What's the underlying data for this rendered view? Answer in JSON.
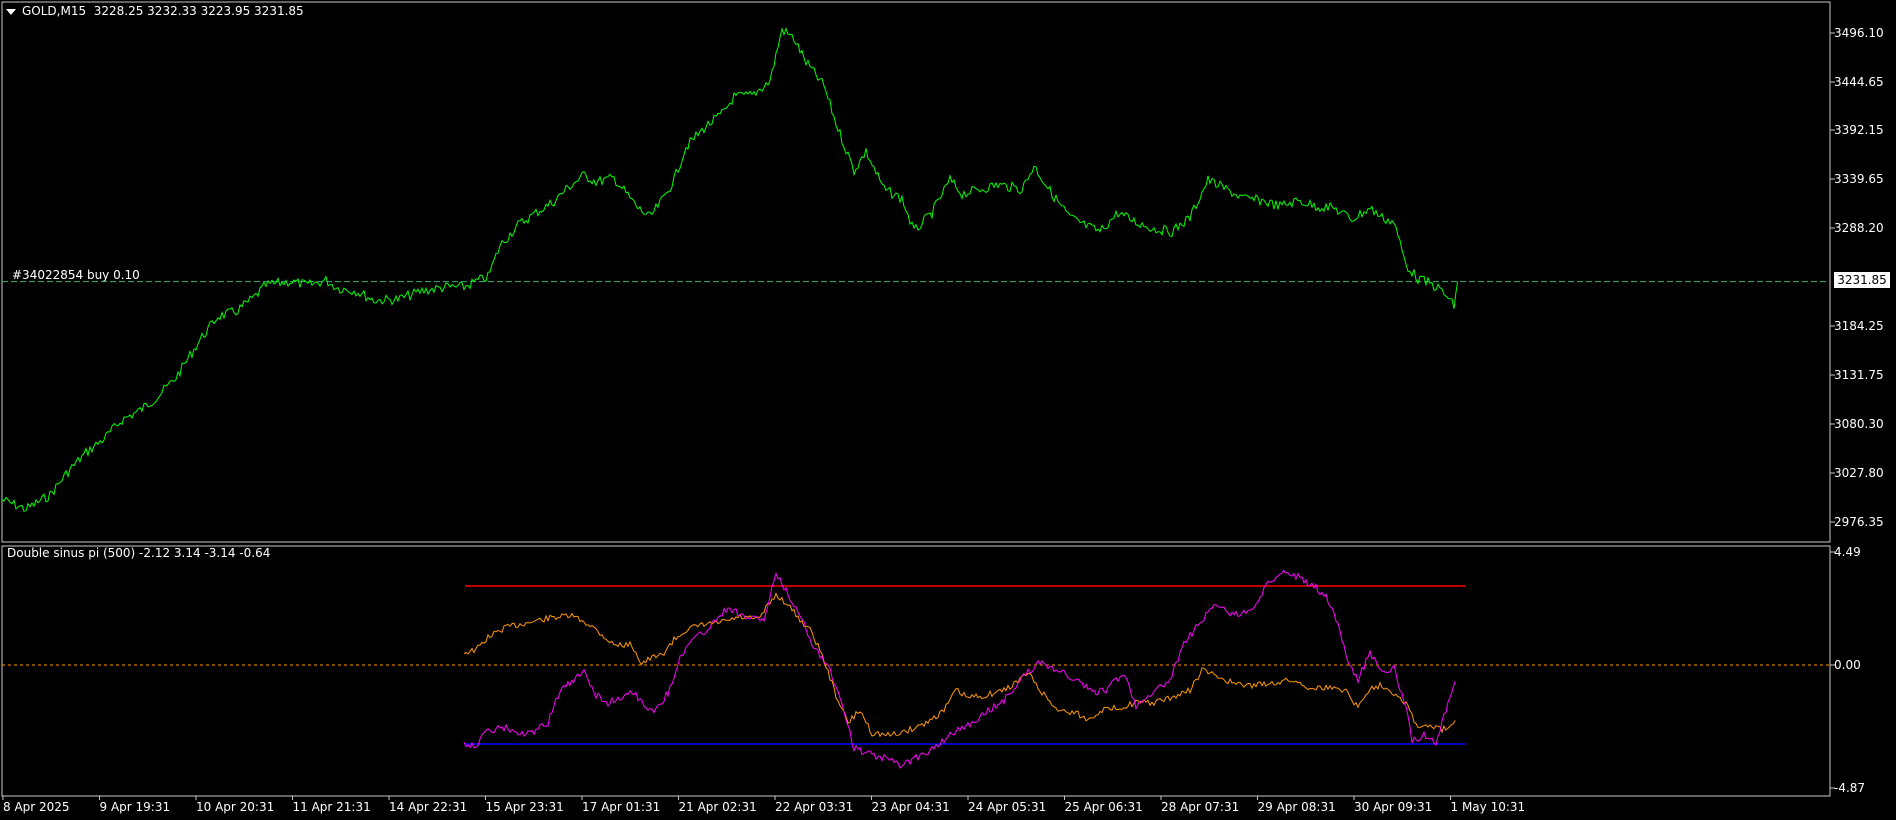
{
  "main": {
    "symbol_menu_icon": "triangle-down-icon",
    "header": "GOLD,M15  3228.25 3232.33 3223.95 3231.85",
    "order_label": "#34022854 buy 0.10",
    "current_price_tag": "3231.85",
    "price_ticks": [
      "3496.10",
      "3444.65",
      "3392.15",
      "3339.65",
      "3288.20",
      "3184.25",
      "3131.75",
      "3080.30",
      "3027.80",
      "2976.35"
    ],
    "colors": {
      "price_line": "#00ff00",
      "order_line": "#3cb371",
      "frame": "#c8c8c8"
    }
  },
  "indicator": {
    "header": "Double sinus pi (500) -2.12 3.14 -3.14 -0.64",
    "ticks": [
      "4.49",
      "0.00",
      "-4.87"
    ],
    "level_upper": 3.14,
    "level_lower": -3.14,
    "colors": {
      "upper_level": "#ff0000",
      "lower_level": "#0000ff",
      "zero_line": "#ff9900",
      "orange_series": "#ff9900",
      "magenta_series": "#ff00ff"
    }
  },
  "time_axis": [
    "8 Apr 2025",
    "9 Apr 19:31",
    "10 Apr 20:31",
    "11 Apr 21:31",
    "14 Apr 22:31",
    "15 Apr 23:31",
    "17 Apr 01:31",
    "21 Apr 02:31",
    "22 Apr 03:31",
    "23 Apr 04:31",
    "24 Apr 05:31",
    "25 Apr 06:31",
    "28 Apr 07:31",
    "29 Apr 08:31",
    "30 Apr 09:31",
    "1 May 10:31"
  ],
  "chart_data": [
    {
      "type": "line",
      "title": "GOLD,M15",
      "ylim": [
        2960,
        3510
      ],
      "series": [
        {
          "name": "GOLD",
          "points": [
            [
              0,
              3000
            ],
            [
              20,
              2990
            ],
            [
              40,
              3005
            ],
            [
              55,
              3030
            ],
            [
              70,
              3050
            ],
            [
              85,
              3065
            ],
            [
              100,
              3085
            ],
            [
              115,
              3095
            ],
            [
              130,
              3110
            ],
            [
              145,
              3130
            ],
            [
              155,
              3150
            ],
            [
              165,
              3170
            ],
            [
              180,
              3195
            ],
            [
              195,
              3200
            ],
            [
              210,
              3215
            ],
            [
              220,
              3228
            ],
            [
              240,
              3232
            ],
            [
              255,
              3228
            ],
            [
              270,
              3233
            ],
            [
              280,
              3225
            ],
            [
              295,
              3222
            ],
            [
              310,
              3212
            ],
            [
              330,
              3213
            ],
            [
              350,
              3222
            ],
            [
              370,
              3226
            ],
            [
              385,
              3226
            ],
            [
              395,
              3232
            ],
            [
              405,
              3237
            ],
            [
              415,
              3270
            ],
            [
              430,
              3292
            ],
            [
              445,
              3305
            ],
            [
              460,
              3317
            ],
            [
              470,
              3330
            ],
            [
              485,
              3345
            ],
            [
              495,
              3338
            ],
            [
              510,
              3342
            ],
            [
              520,
              3326
            ],
            [
              530,
              3310
            ],
            [
              540,
              3300
            ],
            [
              550,
              3318
            ],
            [
              560,
              3340
            ],
            [
              570,
              3375
            ],
            [
              585,
              3395
            ],
            [
              600,
              3410
            ],
            [
              610,
              3428
            ],
            [
              625,
              3430
            ],
            [
              640,
              3445
            ],
            [
              650,
              3500
            ],
            [
              660,
              3490
            ],
            [
              670,
              3465
            ],
            [
              685,
              3440
            ],
            [
              695,
              3400
            ],
            [
              710,
              3350
            ],
            [
              720,
              3370
            ],
            [
              735,
              3330
            ],
            [
              750,
              3320
            ],
            [
              760,
              3285
            ],
            [
              775,
              3305
            ],
            [
              790,
              3340
            ],
            [
              800,
              3325
            ],
            [
              815,
              3330
            ],
            [
              830,
              3335
            ],
            [
              850,
              3330
            ],
            [
              860,
              3355
            ],
            [
              875,
              3325
            ],
            [
              890,
              3300
            ],
            [
              905,
              3290
            ],
            [
              915,
              3285
            ],
            [
              930,
              3305
            ],
            [
              945,
              3295
            ],
            [
              960,
              3288
            ],
            [
              975,
              3285
            ],
            [
              990,
              3300
            ],
            [
              1005,
              3340
            ],
            [
              1020,
              3330
            ],
            [
              1035,
              3320
            ],
            [
              1050,
              3318
            ],
            [
              1065,
              3312
            ],
            [
              1080,
              3318
            ],
            [
              1095,
              3312
            ],
            [
              1110,
              3310
            ],
            [
              1125,
              3298
            ],
            [
              1140,
              3310
            ],
            [
              1150,
              3300
            ],
            [
              1160,
              3295
            ],
            [
              1170,
              3250
            ],
            [
              1180,
              3235
            ],
            [
              1190,
              3230
            ],
            [
              1200,
              3222
            ],
            [
              1210,
              3206
            ],
            [
              1213,
              3231.85
            ]
          ]
        }
      ]
    },
    {
      "type": "line",
      "title": "Double sinus pi (500)",
      "ylim": [
        -4.87,
        4.49
      ],
      "series": [
        {
          "name": "orange",
          "points": [
            [
              385,
              0.5
            ],
            [
              395,
              0.6
            ],
            [
              405,
              1.1
            ],
            [
              420,
              1.5
            ],
            [
              440,
              1.7
            ],
            [
              460,
              1.9
            ],
            [
              475,
              1.95
            ],
            [
              490,
              1.6
            ],
            [
              500,
              1.2
            ],
            [
              510,
              0.8
            ],
            [
              525,
              0.8
            ],
            [
              533,
              0.05
            ],
            [
              540,
              0.25
            ],
            [
              550,
              0.4
            ],
            [
              560,
              1.0
            ],
            [
              570,
              1.4
            ],
            [
              585,
              1.6
            ],
            [
              600,
              1.7
            ],
            [
              615,
              1.9
            ],
            [
              630,
              1.8
            ],
            [
              645,
              2.8
            ],
            [
              655,
              2.4
            ],
            [
              665,
              1.8
            ],
            [
              675,
              1.3
            ],
            [
              685,
              0.2
            ],
            [
              695,
              -1.2
            ],
            [
              705,
              -2.3
            ],
            [
              715,
              -1.8
            ],
            [
              725,
              -2.7
            ],
            [
              740,
              -2.8
            ],
            [
              755,
              -2.6
            ],
            [
              770,
              -2.3
            ],
            [
              785,
              -1.8
            ],
            [
              795,
              -1.0
            ],
            [
              805,
              -1.3
            ],
            [
              820,
              -1.2
            ],
            [
              835,
              -1.0
            ],
            [
              845,
              -0.7
            ],
            [
              855,
              -0.3
            ],
            [
              865,
              -1.0
            ],
            [
              880,
              -1.8
            ],
            [
              895,
              -1.9
            ],
            [
              905,
              -2.2
            ],
            [
              915,
              -1.8
            ],
            [
              930,
              -1.7
            ],
            [
              945,
              -1.5
            ],
            [
              960,
              -1.5
            ],
            [
              975,
              -1.3
            ],
            [
              990,
              -1.0
            ],
            [
              1000,
              -0.2
            ],
            [
              1015,
              -0.5
            ],
            [
              1030,
              -0.8
            ],
            [
              1045,
              -0.8
            ],
            [
              1060,
              -0.7
            ],
            [
              1075,
              -0.6
            ],
            [
              1090,
              -0.9
            ],
            [
              1105,
              -0.9
            ],
            [
              1120,
              -1.0
            ],
            [
              1130,
              -1.7
            ],
            [
              1140,
              -0.9
            ],
            [
              1150,
              -0.8
            ],
            [
              1160,
              -1.1
            ],
            [
              1170,
              -1.5
            ],
            [
              1180,
              -2.5
            ],
            [
              1190,
              -2.4
            ],
            [
              1200,
              -2.6
            ],
            [
              1211,
              -2.2
            ]
          ]
        },
        {
          "name": "magenta",
          "points": [
            [
              385,
              -3.1
            ],
            [
              395,
              -3.2
            ],
            [
              405,
              -2.6
            ],
            [
              420,
              -2.5
            ],
            [
              435,
              -2.8
            ],
            [
              445,
              -2.6
            ],
            [
              455,
              -2.3
            ],
            [
              465,
              -1.0
            ],
            [
              478,
              -0.6
            ],
            [
              485,
              -0.2
            ],
            [
              495,
              -1.2
            ],
            [
              505,
              -1.5
            ],
            [
              515,
              -1.3
            ],
            [
              525,
              -1.0
            ],
            [
              535,
              -1.6
            ],
            [
              545,
              -1.8
            ],
            [
              555,
              -1.1
            ],
            [
              565,
              0.3
            ],
            [
              575,
              1.0
            ],
            [
              585,
              1.3
            ],
            [
              595,
              1.8
            ],
            [
              605,
              2.3
            ],
            [
              620,
              1.9
            ],
            [
              635,
              1.8
            ],
            [
              645,
              3.6
            ],
            [
              655,
              2.8
            ],
            [
              665,
              2.0
            ],
            [
              675,
              0.9
            ],
            [
              690,
              -0.2
            ],
            [
              700,
              -1.5
            ],
            [
              710,
              -3.3
            ],
            [
              720,
              -3.5
            ],
            [
              735,
              -3.7
            ],
            [
              750,
              -4.0
            ],
            [
              765,
              -3.6
            ],
            [
              780,
              -3.2
            ],
            [
              795,
              -2.6
            ],
            [
              805,
              -2.4
            ],
            [
              820,
              -1.9
            ],
            [
              835,
              -1.4
            ],
            [
              850,
              -0.5
            ],
            [
              865,
              0.1
            ],
            [
              880,
              -0.2
            ],
            [
              895,
              -0.6
            ],
            [
              910,
              -1.1
            ],
            [
              920,
              -1.0
            ],
            [
              935,
              -0.3
            ],
            [
              945,
              -1.6
            ],
            [
              955,
              -1.2
            ],
            [
              965,
              -0.9
            ],
            [
              975,
              -0.4
            ],
            [
              985,
              0.8
            ],
            [
              995,
              1.5
            ],
            [
              1010,
              2.4
            ],
            [
              1025,
              2.0
            ],
            [
              1040,
              2.1
            ],
            [
              1055,
              3.2
            ],
            [
              1068,
              3.8
            ],
            [
              1080,
              3.5
            ],
            [
              1095,
              3.1
            ],
            [
              1105,
              2.6
            ],
            [
              1115,
              1.4
            ],
            [
              1120,
              0.4
            ],
            [
              1130,
              -0.6
            ],
            [
              1140,
              0.5
            ],
            [
              1150,
              -0.3
            ],
            [
              1160,
              -0.1
            ],
            [
              1170,
              -1.7
            ],
            [
              1175,
              -3.0
            ],
            [
              1185,
              -2.8
            ],
            [
              1195,
              -3.1
            ],
            [
              1205,
              -1.5
            ],
            [
              1211,
              -0.64
            ]
          ]
        }
      ]
    }
  ]
}
